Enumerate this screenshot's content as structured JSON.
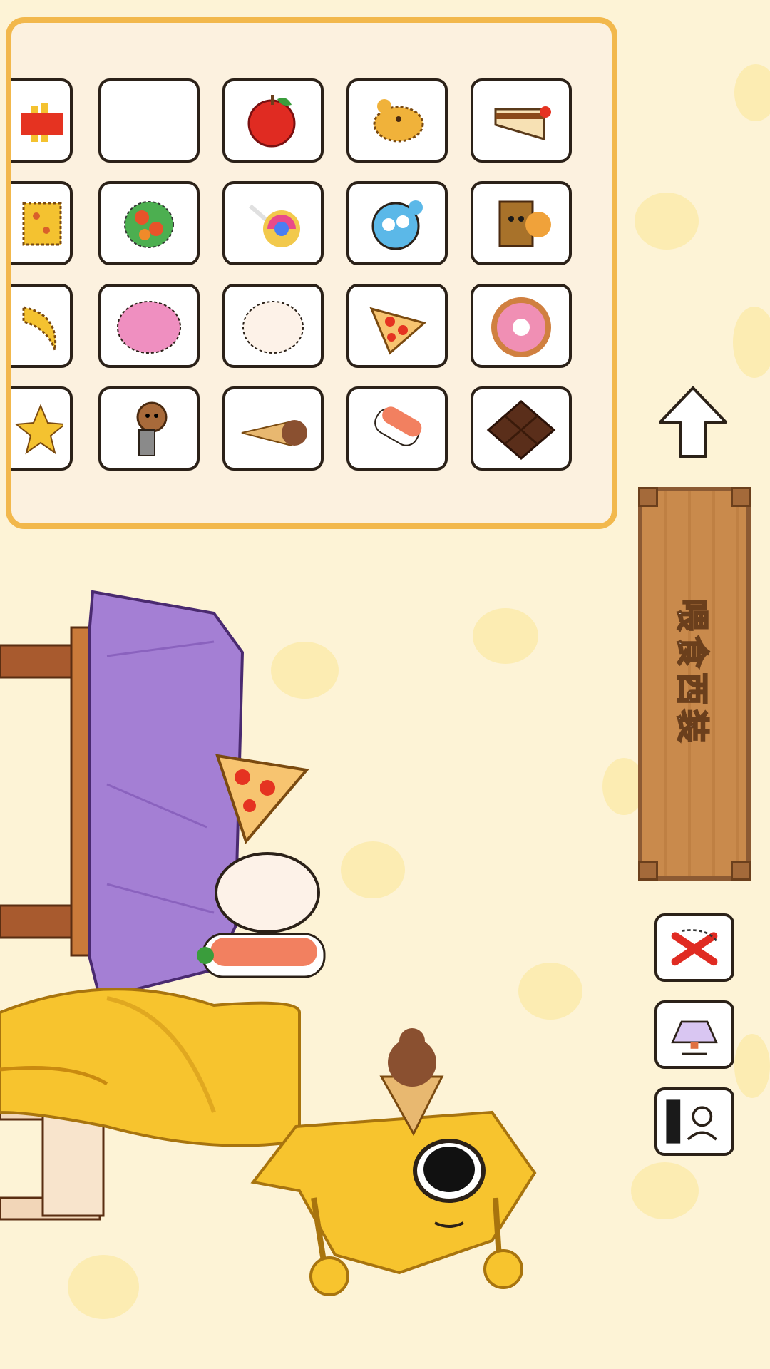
{
  "sign": {
    "label": "喂食西装"
  },
  "food_grid": {
    "rows": [
      [
        "fries-icon",
        "empty-slot",
        "apple-icon",
        "roast-chicken-icon",
        "cake-slice-icon"
      ],
      [
        "cheese-cracker-icon",
        "salad-bowl-icon",
        "lollipop-icon",
        "blue-monster-toy-icon",
        "toast-icon"
      ],
      [
        "banana-icon",
        "pink-ball-icon",
        "egg-icon",
        "pizza-slice-icon",
        "donut-icon"
      ],
      [
        "star-cookie-icon",
        "puppy-toy-icon",
        "ice-cream-cone-icon",
        "sushi-icon",
        "chocolate-bar-icon"
      ]
    ]
  },
  "tools": [
    "cancel-icon",
    "lamp-icon",
    "snapshot-icon"
  ],
  "colors": {
    "background": "#fdf3d6",
    "panel_border": "#f2b84c",
    "cloth": "#a47fd4",
    "chick": "#f7c42e"
  }
}
